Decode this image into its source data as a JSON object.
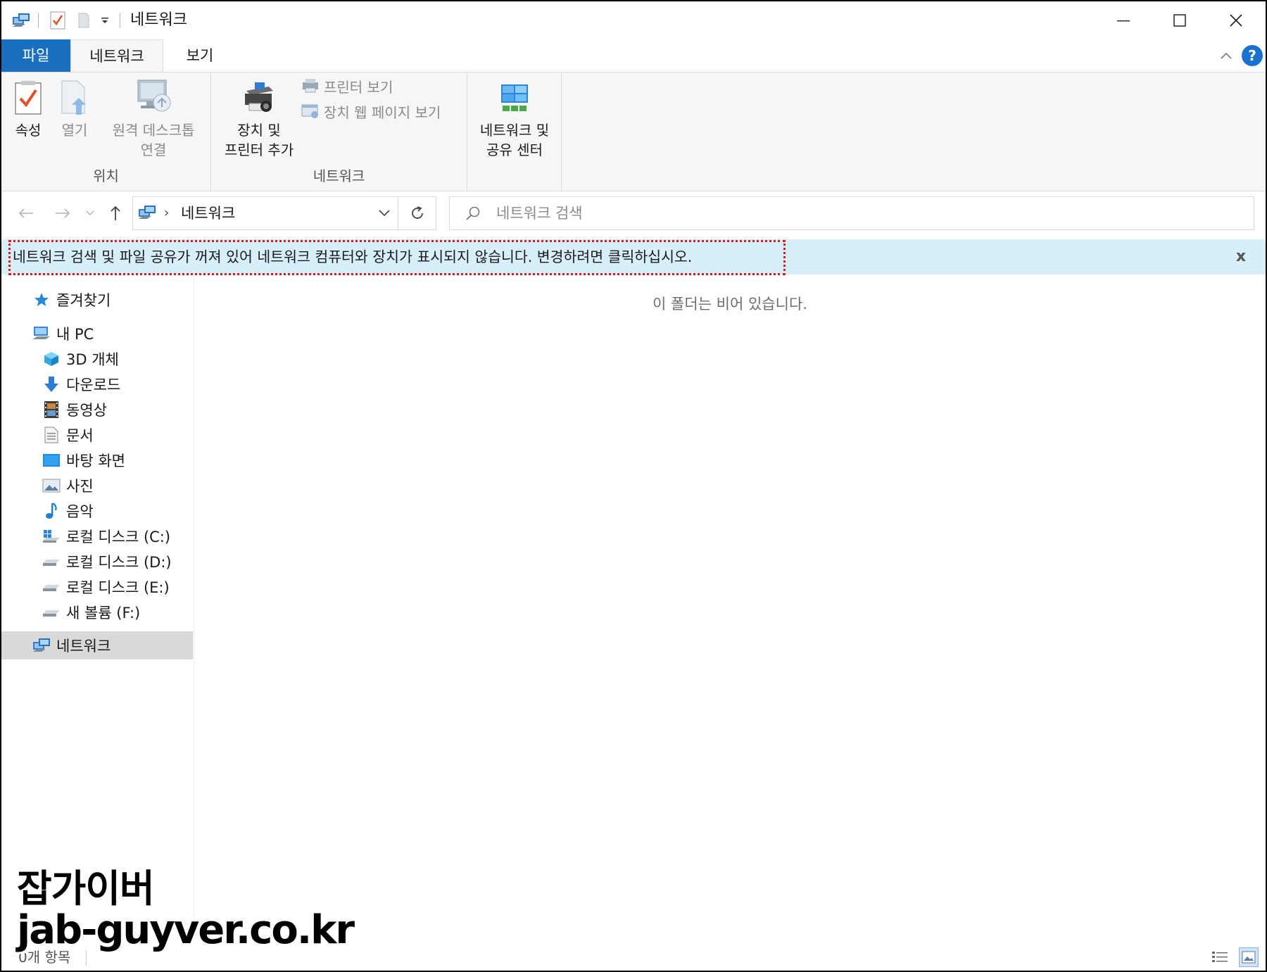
{
  "window": {
    "title": "네트워크",
    "controls": {
      "minimize": "minimize-icon",
      "maximize": "maximize-icon",
      "close": "close-icon"
    }
  },
  "ribbon": {
    "tabs": [
      {
        "label": "파일",
        "active": false
      },
      {
        "label": "네트워크",
        "active": true
      },
      {
        "label": "보기",
        "active": false
      }
    ],
    "help": "?",
    "groups": {
      "location": {
        "label": "위치",
        "properties": "속성",
        "open": "열기",
        "remote_desktop_line1": "원격 데스크톱",
        "remote_desktop_line2": "연결"
      },
      "network": {
        "label": "네트워크",
        "add_device_line1": "장치 및",
        "add_device_line2": "프린터 추가",
        "view_printers": "프린터 보기",
        "view_device_webpage": "장치 웹 페이지 보기"
      },
      "center": {
        "nsc_line1": "네트워크 및",
        "nsc_line2": "공유 센터"
      }
    }
  },
  "address": {
    "path": "네트워크",
    "separator": "›",
    "search_placeholder": "네트워크 검색"
  },
  "infobar": {
    "message": "네트워크 검색 및 파일 공유가 꺼져 있어 네트워크 컴퓨터와 장치가 표시되지 않습니다. 변경하려면 클릭하십시오.",
    "close": "x",
    "highlight_color": "#d11f1f"
  },
  "nav_pane": {
    "items": [
      {
        "label": "즐겨찾기",
        "icon": "star-icon"
      },
      {
        "label": "내 PC",
        "icon": "computer-icon"
      },
      {
        "label": "3D 개체",
        "icon": "cube-icon"
      },
      {
        "label": "다운로드",
        "icon": "download-icon"
      },
      {
        "label": "동영상",
        "icon": "film-icon"
      },
      {
        "label": "문서",
        "icon": "document-icon"
      },
      {
        "label": "바탕 화면",
        "icon": "desktop-icon"
      },
      {
        "label": "사진",
        "icon": "picture-icon"
      },
      {
        "label": "음악",
        "icon": "music-icon"
      },
      {
        "label": "로컬 디스크 (C:)",
        "icon": "windows-drive-icon"
      },
      {
        "label": "로컬 디스크 (D:)",
        "icon": "drive-icon"
      },
      {
        "label": "로컬 디스크 (E:)",
        "icon": "drive-icon"
      },
      {
        "label": "새 볼륨 (F:)",
        "icon": "drive-icon"
      },
      {
        "label": "네트워크",
        "icon": "network-icon",
        "selected": true
      }
    ]
  },
  "content": {
    "empty_message": "이 폴더는 비어 있습니다."
  },
  "status": {
    "item_count": "0개 항목"
  },
  "watermark": {
    "line1": "잡가이버",
    "line2": "jab-guyver.co.kr"
  },
  "colors": {
    "file_tab": "#1a6fbf",
    "infobar_bg": "#d7eefb",
    "selected_nav": "#d9d9d9"
  }
}
